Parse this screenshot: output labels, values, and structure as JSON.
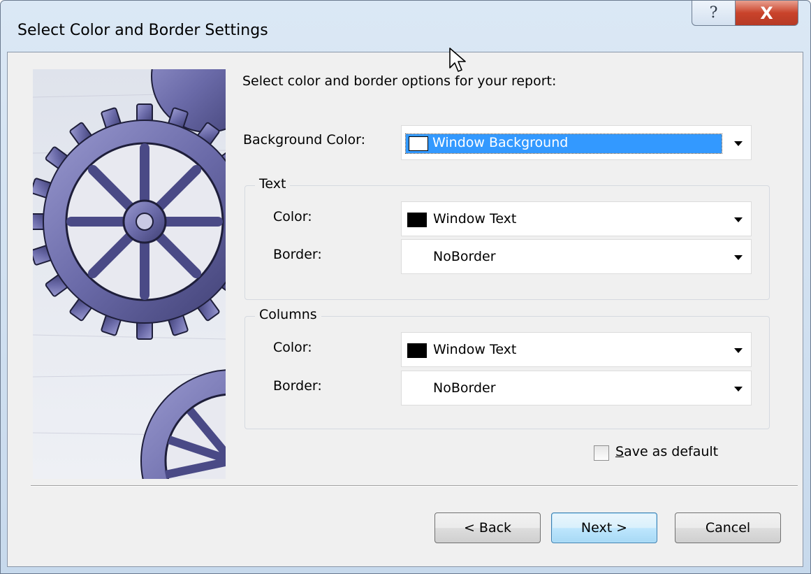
{
  "window": {
    "title": "Select Color and Border Settings",
    "help_glyph": "?",
    "close_glyph": "X"
  },
  "prompt": "Select color and border options for your report:",
  "background_color": {
    "label": "Background Color:",
    "value": "Window Background",
    "swatch_color": "#ffffff"
  },
  "text_group": {
    "label": "Text",
    "color_label": "Color:",
    "color_value": "Window Text",
    "color_swatch": "#000000",
    "border_label": "Border:",
    "border_value": "NoBorder"
  },
  "columns_group": {
    "label": "Columns",
    "color_label": "Color:",
    "color_value": "Window Text",
    "color_swatch": "#000000",
    "border_label": "Border:",
    "border_value": "NoBorder"
  },
  "save_default": {
    "label_rest": "ave as default",
    "accel": "S",
    "checked": false
  },
  "buttons": {
    "back": "< Back",
    "next": "Next >",
    "cancel": "Cancel"
  },
  "colors": {
    "selection": "#3399ff",
    "gear": "#6a6aa8"
  }
}
